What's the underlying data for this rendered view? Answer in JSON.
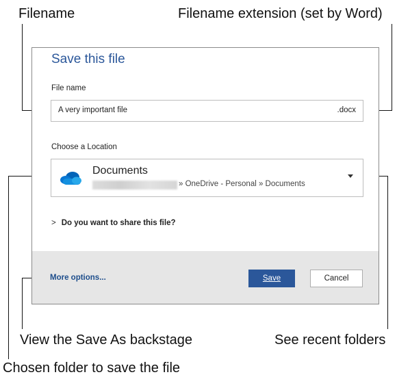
{
  "callouts": {
    "filename": "Filename",
    "extension": "Filename extension (set by Word)",
    "backstage": "View the Save As backstage",
    "recent": "See recent folders",
    "folder": "Chosen folder to save the file"
  },
  "dialog": {
    "title": "Save this file",
    "file_name_label": "File name",
    "file_name_value": "A very important file",
    "extension": ".docx",
    "location_label": "Choose a Location",
    "location_name": "Documents",
    "location_path": "» OneDrive - Personal » Documents",
    "location_icon": "onedrive-cloud-icon",
    "share_prompt": "Do you want to share this file?",
    "more_options": "More options...",
    "save_label": "Save",
    "cancel_label": "Cancel"
  },
  "colors": {
    "accent": "#2b579a",
    "footer_bg": "#e6e6e6",
    "link": "#1e4e8c",
    "cloud": "#0364b8"
  }
}
